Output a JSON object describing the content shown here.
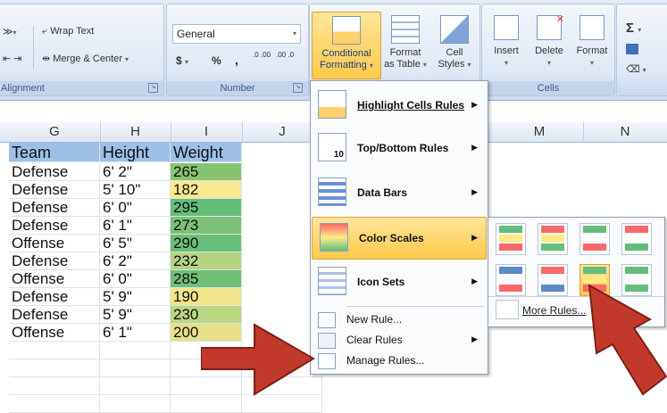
{
  "ribbon": {
    "alignment_group": {
      "label": "Alignment",
      "wrap_text": "Wrap Text",
      "merge_center": "Merge & Center"
    },
    "number_group": {
      "label": "Number",
      "format": "General",
      "currency": "$",
      "percent": "%",
      "comma": ",",
      "inc_decimal": ".0 .00",
      "dec_decimal": ".00 .0"
    },
    "styles_group": {
      "conditional_formatting_1": "Conditional",
      "conditional_formatting_2": "Formatting",
      "format_as_table_1": "Format",
      "format_as_table_2": "as Table",
      "cell_styles_1": "Cell",
      "cell_styles_2": "Styles"
    },
    "cells_group": {
      "label": "Cells",
      "insert": "Insert",
      "delete": "Delete",
      "format": "Format"
    },
    "editing_group": {
      "sigma": "Σ"
    }
  },
  "grid": {
    "columns": [
      "G",
      "H",
      "I",
      "J",
      "M",
      "N"
    ],
    "header": [
      "Team",
      "Height",
      "Weight"
    ],
    "rows": [
      {
        "team": "Defense",
        "height": "6' 2\"",
        "weight": "265",
        "color": "#86c36f"
      },
      {
        "team": "Defense",
        "height": "5' 10\"",
        "weight": "182",
        "color": "#f9e88f"
      },
      {
        "team": "Defense",
        "height": "6' 0\"",
        "weight": "295",
        "color": "#63be7b"
      },
      {
        "team": "Defense",
        "height": "6' 1\"",
        "weight": "273",
        "color": "#7cc274"
      },
      {
        "team": "Offense",
        "height": "6' 5\"",
        "weight": "290",
        "color": "#68bf79"
      },
      {
        "team": "Defense",
        "height": "6' 2\"",
        "weight": "232",
        "color": "#b6d37f"
      },
      {
        "team": "Offense",
        "height": "6' 0\"",
        "weight": "285",
        "color": "#6ec077"
      },
      {
        "team": "Defense",
        "height": "5' 9\"",
        "weight": "190",
        "color": "#f0e48c"
      },
      {
        "team": "Defense",
        "height": "5' 9\"",
        "weight": "230",
        "color": "#bbd580"
      },
      {
        "team": "Offense",
        "height": "6' 1\"",
        "weight": "200",
        "color": "#e6e088"
      }
    ]
  },
  "menu": {
    "items": [
      {
        "label": "Highlight Cells Rules",
        "icon": "highlight-cells-icon"
      },
      {
        "label": "Top/Bottom Rules",
        "icon": "top-bottom-icon"
      },
      {
        "label": "Data Bars",
        "icon": "data-bars-icon"
      },
      {
        "label": "Color Scales",
        "icon": "color-scales-icon"
      },
      {
        "label": "Icon Sets",
        "icon": "icon-sets-icon"
      }
    ],
    "small_items": [
      {
        "label": "New Rule..."
      },
      {
        "label": "Clear Rules"
      },
      {
        "label": "Manage Rules..."
      }
    ],
    "top_bottom_icon_text": "10"
  },
  "submenu": {
    "more_rules": "More Rules..."
  },
  "colors": {
    "accent_arrow": "#c0392b",
    "header_fill": "#9dc0e8",
    "selected": "#ffc94a"
  }
}
